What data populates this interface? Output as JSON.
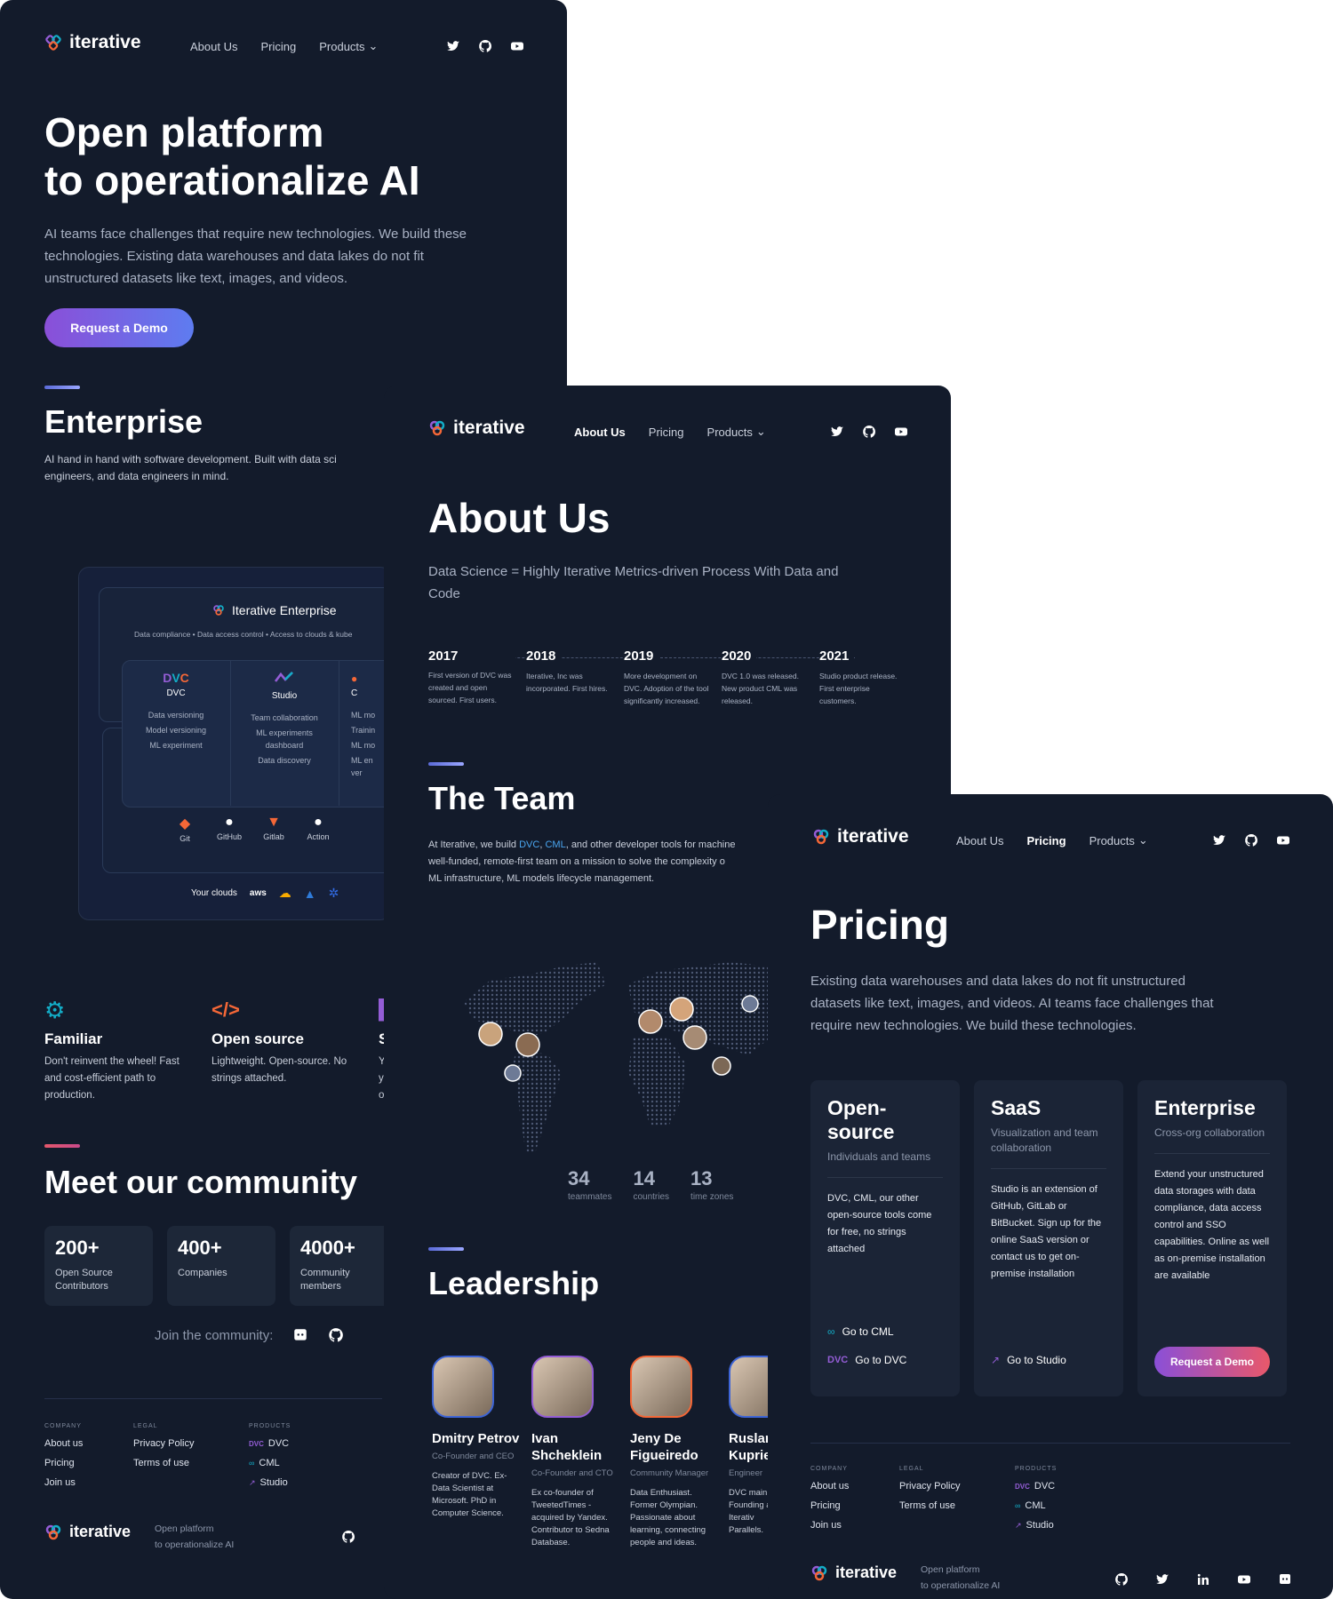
{
  "brand": {
    "name": "iterative",
    "tagline": "Open platform to operationalize AI"
  },
  "nav": {
    "about": "About Us",
    "pricing": "Pricing",
    "products": "Products"
  },
  "home": {
    "hero_line1": "Open platform",
    "hero_line2": "to operationalize AI",
    "hero_text": "AI teams face challenges that require new technologies. We build these technologies. Existing data warehouses and data lakes do not fit unstructured datasets like text, images, and videos.",
    "cta": "Request a Demo",
    "enterprise_title": "Enterprise",
    "enterprise_text": "AI hand in hand with software development. Built with data sci",
    "enterprise_text2": "engineers, and data engineers in mind.",
    "arch": {
      "title": "Iterative Enterprise",
      "subtitle": "Data compliance • Data access control • Access to clouds & kube",
      "dvc_name": "DVC",
      "dvc_items": [
        "Data versioning",
        "Model versioning",
        "ML experiment"
      ],
      "studio_name": "Studio",
      "studio_items": [
        "Team collaboration",
        "ML experiments",
        "dashboard",
        "Data discovery"
      ],
      "third_name": "C",
      "third_items": [
        "ML mo",
        "Trainin",
        "ML mo",
        "ML en",
        "ver"
      ],
      "tools": [
        "Git",
        "GitHub",
        "Gitlab",
        "Action"
      ],
      "clouds_label": "Your clouds",
      "aws_label": "aws"
    },
    "features": [
      {
        "title": "Familiar",
        "text": "Don't reinvent the wheel! Fast and cost-efficient path to production."
      },
      {
        "title": "Open source",
        "text": "Lightweight. Open-source. No strings attached."
      },
      {
        "title": "S",
        "text": "Y y o"
      }
    ],
    "community_title": "Meet our community",
    "stats": [
      {
        "value": "200+",
        "label": "Open Source Contributors"
      },
      {
        "value": "400+",
        "label": "Companies"
      },
      {
        "value": "4000+",
        "label": "Community members"
      }
    ],
    "join": "Join the community:",
    "footer": {
      "company_head": "COMPANY",
      "legal_head": "LEGAL",
      "products_head": "PRODUCTS",
      "company": [
        "About us",
        "Pricing",
        "Join us"
      ],
      "legal": [
        "Privacy Policy",
        "Terms of use"
      ],
      "products": [
        "DVC",
        "CML",
        "Studio"
      ],
      "tagline1": "Open platform",
      "tagline2": "to operationalize AI"
    }
  },
  "about": {
    "title": "About Us",
    "lead": "Data Science = Highly Iterative Metrics-driven Process With Data and Code",
    "timeline": [
      {
        "year": "2017",
        "text": "First version of DVC was created and open sourced. First users."
      },
      {
        "year": "2018",
        "text": "Iterative, Inc was incorporated. First hires."
      },
      {
        "year": "2019",
        "text": "More development on DVC. Adoption of the tool significantly increased."
      },
      {
        "year": "2020",
        "text": "DVC 1.0 was released. New product CML was released."
      },
      {
        "year": "2021",
        "text": "Studio product release. First enterprise customers."
      }
    ],
    "team_title": "The Team",
    "team_text_a": "At Iterative, we build ",
    "team_dvc": "DVC",
    "team_sep": ", ",
    "team_cml": "CML",
    "team_text_b": ", and other developer tools for machine",
    "team_text_c": "well-funded, remote-first team on a mission to solve the complexity o",
    "team_text_d": "ML infrastructure, ML models lifecycle management.",
    "map_stats": [
      {
        "value": "34",
        "label": "teammates"
      },
      {
        "value": "14",
        "label": "countries"
      },
      {
        "value": "13",
        "label": "time zones"
      }
    ],
    "leadership_title": "Leadership",
    "leaders": [
      {
        "name": "Dmitry Petrov",
        "role": "Co-Founder and CEO",
        "bio": "Creator of DVC. Ex-Data Scientist at Microsoft. PhD in Computer Science."
      },
      {
        "name": "Ivan Shcheklein",
        "role": "Co-Founder and CTO",
        "bio": "Ex co-founder of TweetedTimes - acquired by Yandex. Contributor to Sedna Database."
      },
      {
        "name": "Jeny De Figueiredo",
        "role": "Community Manager",
        "bio": "Data Enthusiast. Former Olympian. Passionate about learning, connecting people and ideas."
      },
      {
        "name": "Ruslar Kuprie",
        "role": "Engineer",
        "bio": "DVC main Founding at Iterativ Parallels."
      }
    ]
  },
  "pricing": {
    "title": "Pricing",
    "lead": "Existing data warehouses and data lakes do not fit unstructured datasets like text, images, and videos. AI teams face challenges that require new technologies. We build these technologies.",
    "plans": [
      {
        "name": "Open-source",
        "sub": "Individuals and teams",
        "desc": "DVC, CML, our other open-source tools come for free, no strings attached",
        "links": [
          "Go to CML",
          "Go to DVC"
        ]
      },
      {
        "name": "SaaS",
        "sub": "Visualization and team collaboration",
        "desc": "Studio is an extension of GitHub, GitLab or BitBucket. Sign up for the online SaaS version or contact us to get on-premise installation",
        "links": [
          "Go to Studio"
        ]
      },
      {
        "name": "Enterprise",
        "sub": "Cross-org collaboration",
        "desc": "Extend your unstructured data storages with data compliance, data access control and SSO capabilities. Online as well as on-premise installation are available",
        "cta": "Request a Demo"
      }
    ]
  },
  "colors": {
    "bg": "#131b2b",
    "card": "#1b2436",
    "accent_blue": "#5b6bd8",
    "accent_purple": "#8a4fd8",
    "accent_red": "#e9586a"
  }
}
